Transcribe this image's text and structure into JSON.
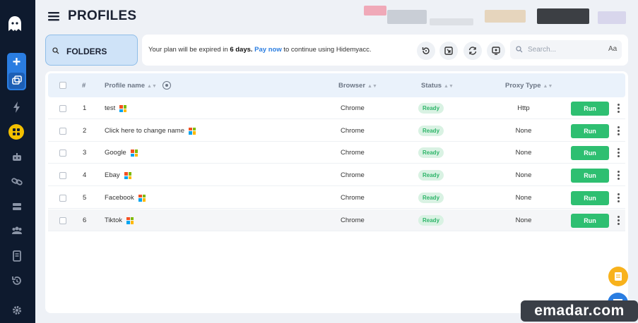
{
  "header": {
    "title": "PROFILES"
  },
  "folders": {
    "label": "FOLDERS"
  },
  "plan": {
    "text_before": "Your plan will be expired in ",
    "days": "6 days.",
    "link": "Pay now",
    "text_after": " to continue using Hidemyacc."
  },
  "search": {
    "placeholder": "Search...",
    "case_toggle": "Aa"
  },
  "table": {
    "columns": {
      "index": "#",
      "name": "Profile name",
      "browser": "Browser",
      "status": "Status",
      "proxy": "Proxy Type"
    },
    "run_label": "Run",
    "rows": [
      {
        "index": "1",
        "name": "test",
        "browser": "Chrome",
        "status": "Ready",
        "proxy": "Http"
      },
      {
        "index": "2",
        "name": "Click here to change name",
        "browser": "Chrome",
        "status": "Ready",
        "proxy": "None"
      },
      {
        "index": "3",
        "name": "Google",
        "browser": "Chrome",
        "status": "Ready",
        "proxy": "None"
      },
      {
        "index": "4",
        "name": "Ebay",
        "browser": "Chrome",
        "status": "Ready",
        "proxy": "None"
      },
      {
        "index": "5",
        "name": "Facebook",
        "browser": "Chrome",
        "status": "Ready",
        "proxy": "None"
      },
      {
        "index": "6",
        "name": "Tiktok",
        "browser": "Chrome",
        "status": "Ready",
        "proxy": "None"
      }
    ]
  },
  "watermark": "emadar.com",
  "colors": {
    "sidebar": "#0e1a2e",
    "accent": "#2a7de1",
    "run": "#2ebf71",
    "ready_badge": "#d9f2e3",
    "active_nav": "#f3c000"
  },
  "icons": {
    "sidebar": [
      "ghost-icon",
      "plus-icon",
      "copy-profiles-icon",
      "lightning-icon",
      "grid-icon",
      "robot-icon",
      "link-icon",
      "server-icon",
      "team-icon",
      "document-icon",
      "history-icon",
      "settings-icon"
    ],
    "toolbar": [
      "restore-icon",
      "import-icon",
      "sync-icon",
      "monitor-icon"
    ]
  }
}
